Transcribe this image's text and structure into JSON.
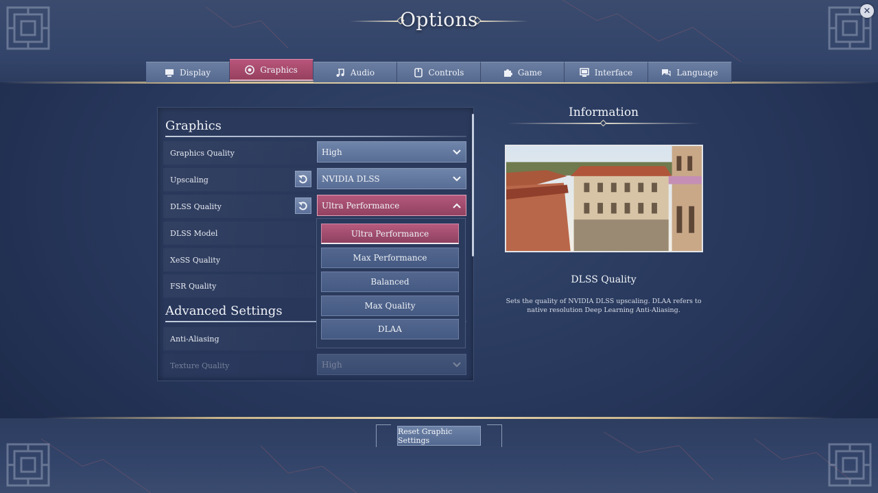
{
  "title": "Options",
  "close_icon": "close-icon",
  "tabs": [
    {
      "label": "Display",
      "icon": "monitor-icon",
      "active": false
    },
    {
      "label": "Graphics",
      "icon": "eye-icon",
      "active": true
    },
    {
      "label": "Audio",
      "icon": "music-note-icon",
      "active": false
    },
    {
      "label": "Controls",
      "icon": "controls-icon",
      "active": false
    },
    {
      "label": "Game",
      "icon": "puzzle-icon",
      "active": false
    },
    {
      "label": "Interface",
      "icon": "screen-icon",
      "active": false
    },
    {
      "label": "Language",
      "icon": "speech-icon",
      "active": false
    }
  ],
  "graphics": {
    "section_title": "Graphics",
    "rows": [
      {
        "label": "Graphics Quality",
        "value": "High"
      },
      {
        "label": "Upscaling",
        "value": "NVIDIA DLSS"
      },
      {
        "label": "DLSS Quality",
        "value": "Ultra Performance"
      },
      {
        "label": "DLSS Model"
      },
      {
        "label": "XeSS Quality"
      },
      {
        "label": "FSR Quality"
      }
    ]
  },
  "advanced": {
    "section_title": "Advanced Settings",
    "rows": [
      {
        "label": "Anti-Aliasing"
      },
      {
        "label": "Texture Quality",
        "value": "High"
      }
    ]
  },
  "dropdown": {
    "options": [
      "Ultra Performance",
      "Max Performance",
      "Balanced",
      "Max Quality",
      "DLAA"
    ],
    "selected": "Ultra Performance"
  },
  "info": {
    "title": "Information",
    "setting_name": "DLSS Quality",
    "description": "Sets the quality of NVIDIA DLSS upscaling. DLAA refers to native resolution Deep Learning Anti-Aliasing."
  },
  "footer": {
    "reset_label": "Reset Graphic Settings"
  },
  "colors": {
    "accent": "#b4587c",
    "background": "#2b3a5c",
    "control": "#6d82a7"
  }
}
